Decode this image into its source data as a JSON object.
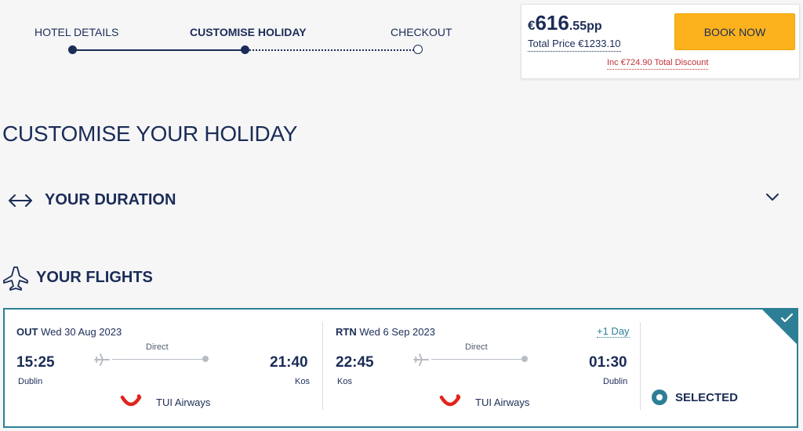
{
  "stepper": {
    "steps": [
      {
        "label": "HOTEL DETAILS",
        "state": "done"
      },
      {
        "label": "CUSTOMISE HOLIDAY",
        "state": "current"
      },
      {
        "label": "CHECKOUT",
        "state": "pending"
      }
    ]
  },
  "price": {
    "currency": "€",
    "per_person_int": "616",
    "per_person_dec": ".55pp",
    "total": "Total Price €1233.10",
    "discount": "Inc €724.90 Total Discount",
    "book_label": "BOOK NOW"
  },
  "page": {
    "title": "CUSTOMISE YOUR HOLIDAY"
  },
  "sections": {
    "duration": "YOUR DURATION",
    "flights": "YOUR FLIGHTS"
  },
  "flights": {
    "outbound": {
      "tag": "OUT",
      "date": "Wed 30 Aug 2023",
      "type": "Direct",
      "depart_time": "15:25",
      "depart_place": "Dublin",
      "arrive_time": "21:40",
      "arrive_place": "Kos",
      "airline": "TUI Airways"
    },
    "return": {
      "tag": "RTN",
      "date": "Wed 6 Sep 2023",
      "type": "Direct",
      "depart_time": "22:45",
      "depart_place": "Kos",
      "arrive_time": "01:30",
      "arrive_place": "Dublin",
      "airline": "TUI Airways",
      "day_offset": "+1 Day"
    },
    "selected_label": "SELECTED"
  },
  "colors": {
    "navy": "#1b2c56",
    "accent": "#fbb21d",
    "teal": "#2d7f95",
    "discount_red": "#c0313a",
    "tui_red": "#e2231a"
  },
  "icons": {
    "duration": "arrows-horizontal-icon",
    "expand": "chevron-down-icon",
    "flights": "airplane-icon",
    "route": "airplane-icon",
    "airline_logo": "tui-smile-logo",
    "selected": "radio-selected-icon",
    "selected_corner": "checkmark-icon"
  }
}
